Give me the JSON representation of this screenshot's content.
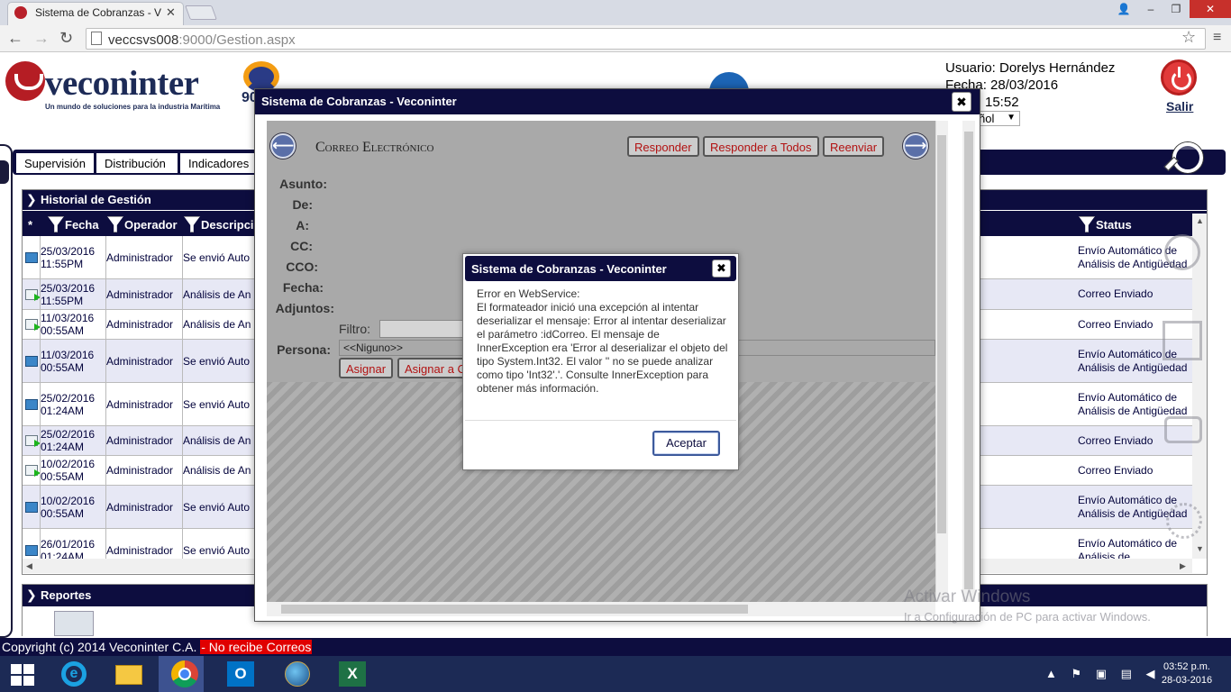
{
  "browser": {
    "tab_title": "Sistema de Cobranzas - V",
    "tab_close": "✕",
    "url_host": "veccsvs008",
    "url_rest": ":9000/Gestion.aspx",
    "minimize": "–",
    "restore": "❐",
    "close": "✕",
    "user_glyph": "👤"
  },
  "header": {
    "logo": "veconinter",
    "tagline": "Un mundo de soluciones para la industria Marítima",
    "iso_code": "90",
    "user_line": "Usuario: Dorelys Hernández",
    "date_line": "Fecha: 28/03/2016",
    "time_line": "15:52",
    "language_value": "ñol",
    "logout_label": "Salir"
  },
  "menu": {
    "tabs": [
      "Supervisión",
      "Distribución",
      "Indicadores"
    ]
  },
  "history": {
    "title": "Historial de Gestión",
    "col_mark": "*",
    "columns": {
      "date": "Fecha",
      "operator": "Operador",
      "description": "Descripci",
      "status": "Status"
    },
    "rows": [
      {
        "icon": "doc",
        "date": "25/03/2016 11:55PM",
        "operator": "Administrador",
        "description": "Se envió Auto",
        "status": "Envío Automático de Análisis de Antigüedad"
      },
      {
        "icon": "mail",
        "date": "25/03/2016 11:55PM",
        "operator": "Administrador",
        "description": "Análisis de An",
        "status": "Correo Enviado"
      },
      {
        "icon": "mail",
        "date": "11/03/2016 00:55AM",
        "operator": "Administrador",
        "description": "Análisis de An",
        "status": "Correo Enviado"
      },
      {
        "icon": "doc",
        "date": "11/03/2016 00:55AM",
        "operator": "Administrador",
        "description": "Se envió Auto",
        "status": "Envío Automático de Análisis de Antigüedad"
      },
      {
        "icon": "doc",
        "date": "25/02/2016 01:24AM",
        "operator": "Administrador",
        "description": "Se envió Auto",
        "status": "Envío Automático de Análisis de Antigüedad"
      },
      {
        "icon": "mail",
        "date": "25/02/2016 01:24AM",
        "operator": "Administrador",
        "description": "Análisis de An",
        "status": "Correo Enviado"
      },
      {
        "icon": "mail",
        "date": "10/02/2016 00:55AM",
        "operator": "Administrador",
        "description": "Análisis de An",
        "status": "Correo Enviado"
      },
      {
        "icon": "doc",
        "date": "10/02/2016 00:55AM",
        "operator": "Administrador",
        "description": "Se envió Auto",
        "status": "Envío Automático de Análisis de Antigüedad"
      },
      {
        "icon": "doc",
        "date": "26/01/2016 01:24AM",
        "operator": "Administrador",
        "description": "Se envió Auto",
        "status": "Envío Automático de Análisis de"
      }
    ]
  },
  "reports": {
    "title": "Reportes"
  },
  "footer": {
    "copyright": "Copyright (c) 2014 Veconinter C.A. ",
    "warning": "- No recibe Correos"
  },
  "watermark": {
    "line1": "Activar Windows",
    "line2": "Ir a Configuración de PC para activar Windows."
  },
  "modal": {
    "title": "Sistema de Cobranzas - Veconinter",
    "close": "✖",
    "mail_title": "Correo Electrónico",
    "buttons": {
      "reply": "Responder",
      "reply_all": "Responder a Todos",
      "forward": "Reenviar"
    },
    "fields": {
      "subject": "Asunto:",
      "from": "De:",
      "to": "A:",
      "cc": "CC:",
      "bcc": "CCO:",
      "date": "Fecha:",
      "attachments": "Adjuntos:",
      "filter": "Filtro:",
      "person": "Persona:"
    },
    "person_value": "<<Niguno>>",
    "assign": "Asignar",
    "assign_to": "Asignar a C",
    "back": "⟵",
    "next": "⟶"
  },
  "alert": {
    "title": "Sistema de Cobranzas - Veconinter",
    "close": "✖",
    "message": "Error en WebService:\nEl formateador inició una excepción al intentar deserializar el mensaje: Error al intentar deserializar el parámetro :idCorreo. El mensaje de InnerException era 'Error al deserializar el objeto del tipo System.Int32. El valor '' no se puede analizar como tipo 'Int32'.'. Consulte InnerException para obtener más información.",
    "ok": "Aceptar"
  },
  "taskbar": {
    "tray": "▲ ⚑ ▣ ▤ ◀",
    "time": "03:52 p.m.",
    "date": "28-03-2016"
  }
}
